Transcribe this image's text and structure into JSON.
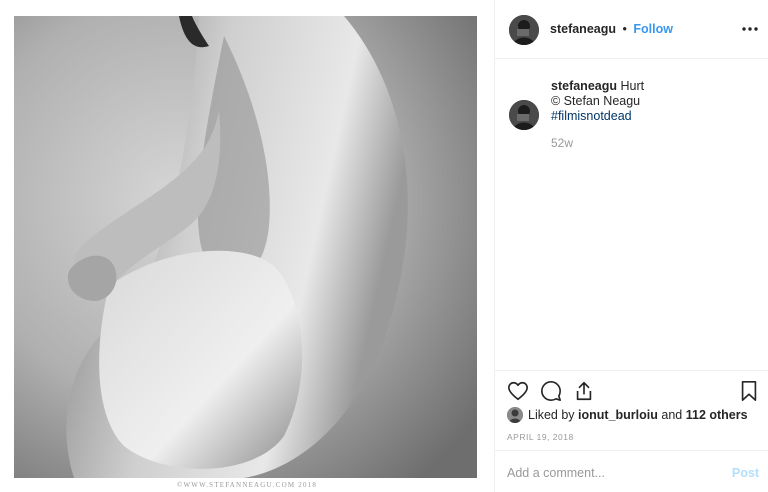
{
  "post": {
    "watermark": "©WWW.STEFANNEAGU.COM 2018"
  },
  "header": {
    "username": "stefaneagu",
    "separator": "•",
    "follow_label": "Follow",
    "more_icon": "more-options-icon"
  },
  "caption": {
    "username": "stefaneagu",
    "title": "Hurt",
    "copyright": "© Stefan Neagu",
    "hashtag": "#filmisnotdead",
    "age": "52w"
  },
  "actions": {
    "like_icon": "heart-icon",
    "comment_icon": "comment-bubble-icon",
    "share_icon": "share-icon",
    "save_icon": "bookmark-icon"
  },
  "likes": {
    "prefix": "Liked by",
    "liker": "ionut_burloiu",
    "connector": "and",
    "others": "112 others"
  },
  "date": "APRIL 19, 2018",
  "comment": {
    "placeholder": "Add a comment...",
    "post_label": "Post"
  },
  "colors": {
    "link_blue": "#3897f0",
    "hashtag_blue": "#003569",
    "muted_gray": "#999999",
    "post_disabled": "#b2dffc",
    "border": "#efefef"
  }
}
